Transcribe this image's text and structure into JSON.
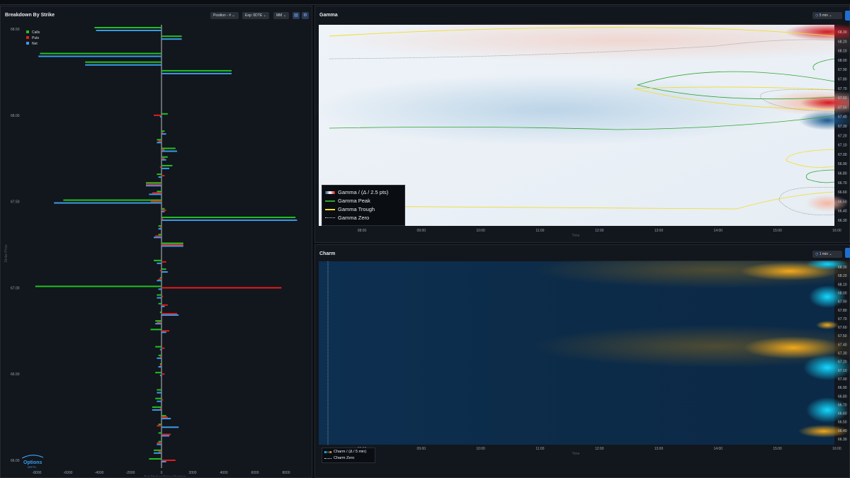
{
  "breakdown": {
    "title": "Breakdown By Strike",
    "controls": {
      "position": "Position - #",
      "expiry": "Exp: 0DTE",
      "mm": "MM"
    },
    "legend": [
      "Calls",
      "Puts",
      "Net"
    ],
    "y_axis_label": "Strike Price",
    "x_axis_label": "Net Market Maker Position",
    "logo_text": "Options",
    "logo_sub": "DEPTH",
    "colors": {
      "calls": "#1fc21f",
      "puts": "#e51c1c",
      "net": "#3a9be8"
    }
  },
  "gamma": {
    "title": "Gamma",
    "interval": "5 min",
    "x_title": "Time",
    "legend": [
      "Gamma / (Δ / 2.5 pts)",
      "Gamma Peak",
      "Gamma Trough",
      "Gamma Zero"
    ]
  },
  "charm": {
    "title": "Charm",
    "interval": "1 min",
    "x_title": "Time",
    "legend": [
      "Charm / (Δ / 5 min)",
      "Charm Zero"
    ]
  },
  "chart_data": [
    {
      "type": "bar",
      "orientation": "horizontal",
      "title": "Breakdown By Strike",
      "ylabel": "Strike Price",
      "xlabel": "Net Market Maker Position",
      "xlim": [
        -9000,
        9000
      ],
      "x_ticks": [
        -8000,
        -6000,
        -4000,
        -2000,
        0,
        2000,
        4000,
        6000,
        8000
      ],
      "strike_tick_labels": [
        "68.50",
        "68.00",
        "67.50",
        "67.00",
        "66.50",
        "66.00"
      ],
      "legend_position": "top-left",
      "strikes": [
        6850,
        6845,
        6840,
        6835,
        6830,
        6825,
        6820,
        6815,
        6810,
        6805,
        6800,
        6795,
        6790,
        6785,
        6780,
        6775,
        6770,
        6765,
        6760,
        6755,
        6750,
        6745,
        6740,
        6735,
        6730,
        6725,
        6720,
        6715,
        6710,
        6705,
        6700,
        6695,
        6690,
        6685,
        6680,
        6675,
        6670,
        6665,
        6660,
        6655,
        6650,
        6645,
        6640,
        6635,
        6630,
        6625,
        6620,
        6615,
        6610,
        6605,
        6600
      ],
      "series": [
        {
          "name": "Calls",
          "values": [
            -4300,
            1300,
            0,
            -7800,
            -4900,
            4500,
            0,
            0,
            0,
            0,
            400,
            0,
            200,
            -300,
            900,
            400,
            700,
            -300,
            -1000,
            -300,
            -6300,
            200,
            8600,
            -200,
            -200,
            1400,
            0,
            -500,
            300,
            -100,
            -8100,
            -300,
            -200,
            -100,
            -400,
            -700,
            0,
            -400,
            -200,
            -100,
            -400,
            0,
            -300,
            -400,
            -600,
            300,
            -200,
            -200,
            -200,
            -500,
            -800
          ]
        },
        {
          "name": "Puts",
          "values": [
            0,
            0,
            0,
            0,
            0,
            0,
            0,
            0,
            0,
            0,
            -500,
            0,
            100,
            -200,
            200,
            200,
            -100,
            200,
            -1000,
            -600,
            -700,
            300,
            100,
            -100,
            -400,
            1400,
            0,
            300,
            -100,
            -200,
            7700,
            100,
            400,
            1000,
            -300,
            500,
            0,
            200,
            -100,
            -100,
            200,
            0,
            0,
            100,
            -100,
            400,
            -300,
            600,
            -300,
            -200,
            900
          ]
        },
        {
          "name": "Net",
          "values": [
            -4200,
            1300,
            0,
            -7900,
            -4900,
            4500,
            0,
            0,
            0,
            0,
            -100,
            0,
            300,
            -300,
            1000,
            300,
            500,
            -200,
            -1000,
            -800,
            -6900,
            200,
            8700,
            -200,
            -500,
            1400,
            0,
            -300,
            400,
            -300,
            -200,
            -300,
            200,
            1100,
            -400,
            300,
            0,
            -100,
            -300,
            -200,
            -100,
            0,
            -300,
            -300,
            -600,
            600,
            1100,
            500,
            -300,
            -500,
            300
          ]
        }
      ]
    },
    {
      "type": "heatmap",
      "title": "Gamma",
      "xlabel": "Time",
      "x_ticks": [
        "08:00",
        "09:00",
        "10:00",
        "11:00",
        "12:00",
        "13:00",
        "14:00",
        "15:00",
        "16:00"
      ],
      "y_ticks": [
        "68.30",
        "68.20",
        "68.10",
        "68.00",
        "67.90",
        "67.80",
        "67.70",
        "67.60",
        "67.50",
        "67.40",
        "67.30",
        "67.20",
        "67.10",
        "67.00",
        "66.90",
        "66.80",
        "66.70",
        "66.60",
        "66.50",
        "66.40",
        "66.30"
      ],
      "series": [
        "Gamma / (Δ / 2.5 pts)",
        "Gamma Peak",
        "Gamma Trough",
        "Gamma Zero"
      ],
      "legend_position": "bottom-left"
    },
    {
      "type": "heatmap",
      "title": "Charm",
      "xlabel": "Time",
      "x_ticks": [
        "08:00",
        "09:00",
        "10:00",
        "11:00",
        "12:00",
        "13:00",
        "14:00",
        "15:00",
        "16:00"
      ],
      "y_ticks": [
        "68.30",
        "68.20",
        "68.10",
        "68.00",
        "67.90",
        "67.80",
        "67.70",
        "67.60",
        "67.50",
        "67.40",
        "67.30",
        "67.20",
        "67.10",
        "67.00",
        "66.90",
        "66.80",
        "66.70",
        "66.60",
        "66.50",
        "66.40",
        "66.30"
      ],
      "series": [
        "Charm / (Δ / 5 min)",
        "Charm Zero"
      ],
      "legend_position": "bottom-left"
    }
  ]
}
